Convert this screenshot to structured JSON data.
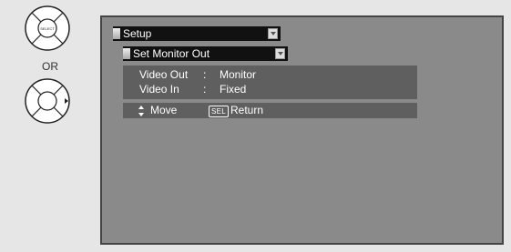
{
  "remote": {
    "select_label": "SELECT",
    "or_label": "OR"
  },
  "menu": {
    "title": "Setup",
    "submenu_title": "Set Monitor Out"
  },
  "settings": [
    {
      "label": "Video Out",
      "separator": ":",
      "value": "Monitor"
    },
    {
      "label": "Video In",
      "separator": ":",
      "value": "Fixed"
    }
  ],
  "footer": {
    "move_label": "Move",
    "sel_key": "SEL",
    "return_label": "Return"
  }
}
